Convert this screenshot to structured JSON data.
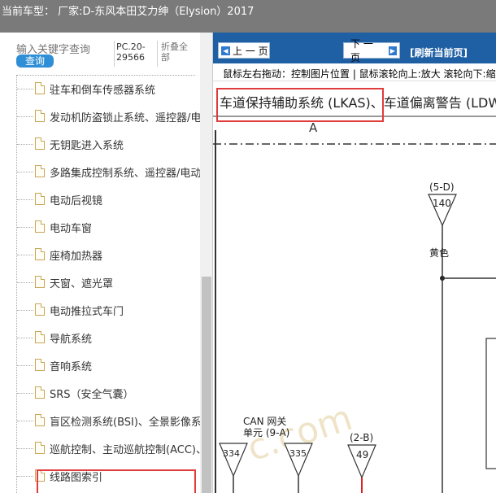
{
  "titlebar": {
    "text": "当前车型： 厂家:D-东风本田艾力绅（Elysion）2017"
  },
  "sidebar": {
    "search_placeholder": "输入关键字查询",
    "search_button": "查询",
    "pc_number": "PC.20-29566",
    "collapse_all": "折叠全部",
    "items": [
      {
        "label": "驻车和倒车传感器系统"
      },
      {
        "label": "发动机防盗锁止系统、遥控器/电"
      },
      {
        "label": "无钥匙进入系统"
      },
      {
        "label": "多路集成控制系统、遥控器/电动"
      },
      {
        "label": "电动后视镜"
      },
      {
        "label": "电动车窗"
      },
      {
        "label": "座椅加热器"
      },
      {
        "label": "天窗、遮光罩"
      },
      {
        "label": "电动推拉式车门"
      },
      {
        "label": "导航系统"
      },
      {
        "label": "音响系统"
      },
      {
        "label": "SRS（安全气囊）"
      },
      {
        "label": "盲区检测系统(BSI)、全景影像系"
      },
      {
        "label": "巡航控制、主动巡航控制(ACC)、"
      },
      {
        "label": "线路图索引"
      }
    ]
  },
  "viewer": {
    "prev_button": "上 一 页",
    "next_button": "下 一 页",
    "refresh": "[刷新当前页]",
    "hint": "鼠标左右拖动：控制图片位置 | 鼠标滚轮向上:放大   滚轮向下:缩",
    "heading": "车道保持辅助系统 (LKAS)、车道偏离警告 (LDW",
    "diagram": {
      "section_label": "A",
      "connector_top_id": "(5-D)",
      "connector_top_num": "140",
      "wire_color": "黄色",
      "can_label_1": "CAN 网关",
      "can_label_2": "单元 (9-A)",
      "connector_334": "334",
      "connector_335": "335",
      "connector_2b_id": "(2-B)",
      "connector_49": "49",
      "watermark": "c.com"
    }
  },
  "colors": {
    "titlebar_bg": "#7a7a7a",
    "navbar_bg": "#1f5fa3",
    "search_button_bg": "#2f8fd6",
    "highlight": "#e03c3c"
  }
}
